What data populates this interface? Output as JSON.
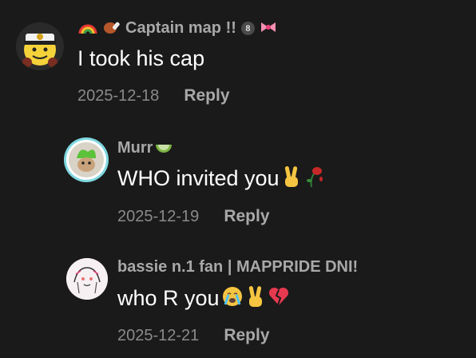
{
  "comments": [
    {
      "username": "Captain map !!",
      "prefix_emoji": [
        "rainbow",
        "meat-on-bone"
      ],
      "suffix_badges": [
        "8-ball",
        "ribbon"
      ],
      "text": "I took his cap",
      "text_emoji": [],
      "date": "2025-12-18",
      "reply_label": "Reply",
      "avatar": "captain-emoji-avatar"
    },
    {
      "username": "Murr",
      "suffix_badges": [
        "lime"
      ],
      "text": "WHO invited you",
      "text_emoji": [
        "victory-hand",
        "wilted-rose"
      ],
      "date": "2025-12-19",
      "reply_label": "Reply",
      "avatar": "green-ring-avatar"
    },
    {
      "username": "bassie n.1 fan | MAPPRIDE DNI!",
      "suffix_badges": [],
      "text": "who R you",
      "text_emoji": [
        "loudly-crying-face",
        "victory-hand",
        "broken-heart"
      ],
      "date": "2025-12-21",
      "reply_label": "Reply",
      "avatar": "sketch-avatar"
    }
  ],
  "colors": {
    "background": "#1a1a1a",
    "username": "#a8a8a8",
    "text": "#ffffff",
    "date": "#8a8a8a",
    "reply": "#a8a8a8",
    "ring": "#7fd8e0"
  }
}
